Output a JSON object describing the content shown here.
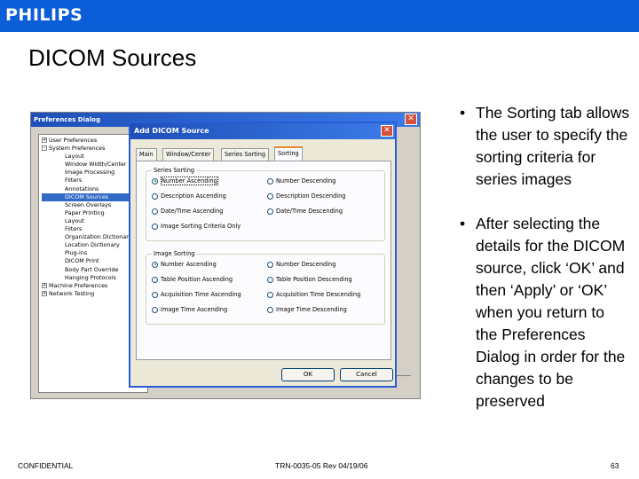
{
  "header": {
    "logo": "PHILIPS"
  },
  "slide": {
    "title": "DICOM Sources"
  },
  "preferences_dialog": {
    "title": "Preferences Dialog",
    "tree": [
      {
        "label": "User Preferences",
        "level": 1,
        "expander": "+"
      },
      {
        "label": "System Preferences",
        "level": 1,
        "expander": "-"
      },
      {
        "label": "Layout",
        "level": 2
      },
      {
        "label": "Window Width/Center",
        "level": 2
      },
      {
        "label": "Image Processing",
        "level": 2
      },
      {
        "label": "Filters",
        "level": 2
      },
      {
        "label": "Annotations",
        "level": 2
      },
      {
        "label": "DICOM Sources",
        "level": 2,
        "selected": true
      },
      {
        "label": "Screen Overlays",
        "level": 2
      },
      {
        "label": "Paper Printing",
        "level": 2
      },
      {
        "label": "Layout",
        "level": 2
      },
      {
        "label": "Filters",
        "level": 2
      },
      {
        "label": "Organization Dictionary",
        "level": 2
      },
      {
        "label": "Location Dictionary",
        "level": 2
      },
      {
        "label": "Plug-ins",
        "level": 2
      },
      {
        "label": "DICOM Print",
        "level": 2
      },
      {
        "label": "Body Part Override",
        "level": 2
      },
      {
        "label": "Hanging Protocols",
        "level": 2
      },
      {
        "label": "Machine Preferences",
        "level": 1,
        "expander": "+"
      },
      {
        "label": "Network Testing",
        "level": 1,
        "expander": "+"
      }
    ]
  },
  "add_dicom_dialog": {
    "title": "Add DICOM Source",
    "tabs": [
      "Main",
      "Window/Center",
      "Series Sorting",
      "Sorting"
    ],
    "series_sorting": {
      "label": "Series Sorting",
      "options": [
        "Number Ascending",
        "Number Descending",
        "Description Ascending",
        "Description Descending",
        "Date/Time Ascending",
        "Date/Time Descending",
        "Image Sorting Criteria Only"
      ],
      "selected": "Number Ascending"
    },
    "image_sorting": {
      "label": "Image Sorting",
      "options": [
        "Number Ascending",
        "Number Descending",
        "Table Position Ascending",
        "Table Position Descending",
        "Acquisition Time Ascending",
        "Acquisition Time Descending",
        "Image Time Ascending",
        "Image Time Descending"
      ],
      "selected": "Number Ascending"
    },
    "ok_label": "OK",
    "cancel_label": "Cancel"
  },
  "bullets": [
    "The Sorting tab allows the user to specify the sorting criteria for series images",
    "After selecting the details for the DICOM source, click ‘OK’ and then ‘Apply’ or ‘OK’ when you return to the Preferences Dialog in order for the changes to be preserved"
  ],
  "footer": {
    "left": "CONFIDENTIAL",
    "center": "TRN-0035-05 Rev 04/19/06",
    "page": "63"
  },
  "colors": {
    "brand": "#0b5ed7",
    "titlebar": "#1e4fb8"
  },
  "icons": {
    "close": "close-icon",
    "expand": "plus-icon",
    "collapse": "minus-icon"
  }
}
